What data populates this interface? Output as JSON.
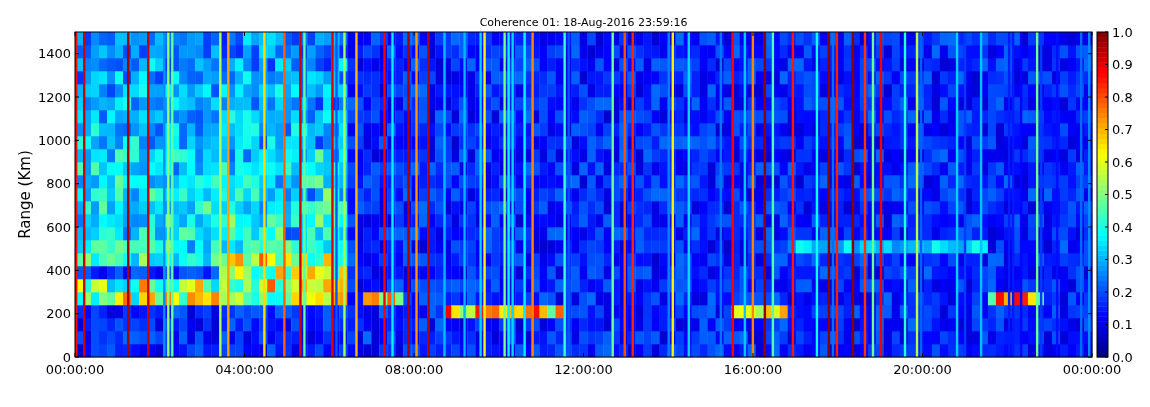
{
  "plot": {
    "title": "Coherence 01: 18-Aug-2016 23:59:16",
    "ylabel": "Range (Km)",
    "yticks": [
      "1400",
      "1200",
      "1000",
      "800",
      "600",
      "400",
      "200",
      "0"
    ],
    "xticks": [
      "00:00:00",
      "04:00:00",
      "08:00:00",
      "12:00:00",
      "16:00:00",
      "20:00:00",
      "00:00:00"
    ],
    "colorbar_ticks": [
      "1.0",
      "0.9",
      "0.8",
      "0.7",
      "0.6",
      "0.5",
      "0.4",
      "0.3",
      "0.2",
      "0.1",
      "0.0"
    ]
  }
}
